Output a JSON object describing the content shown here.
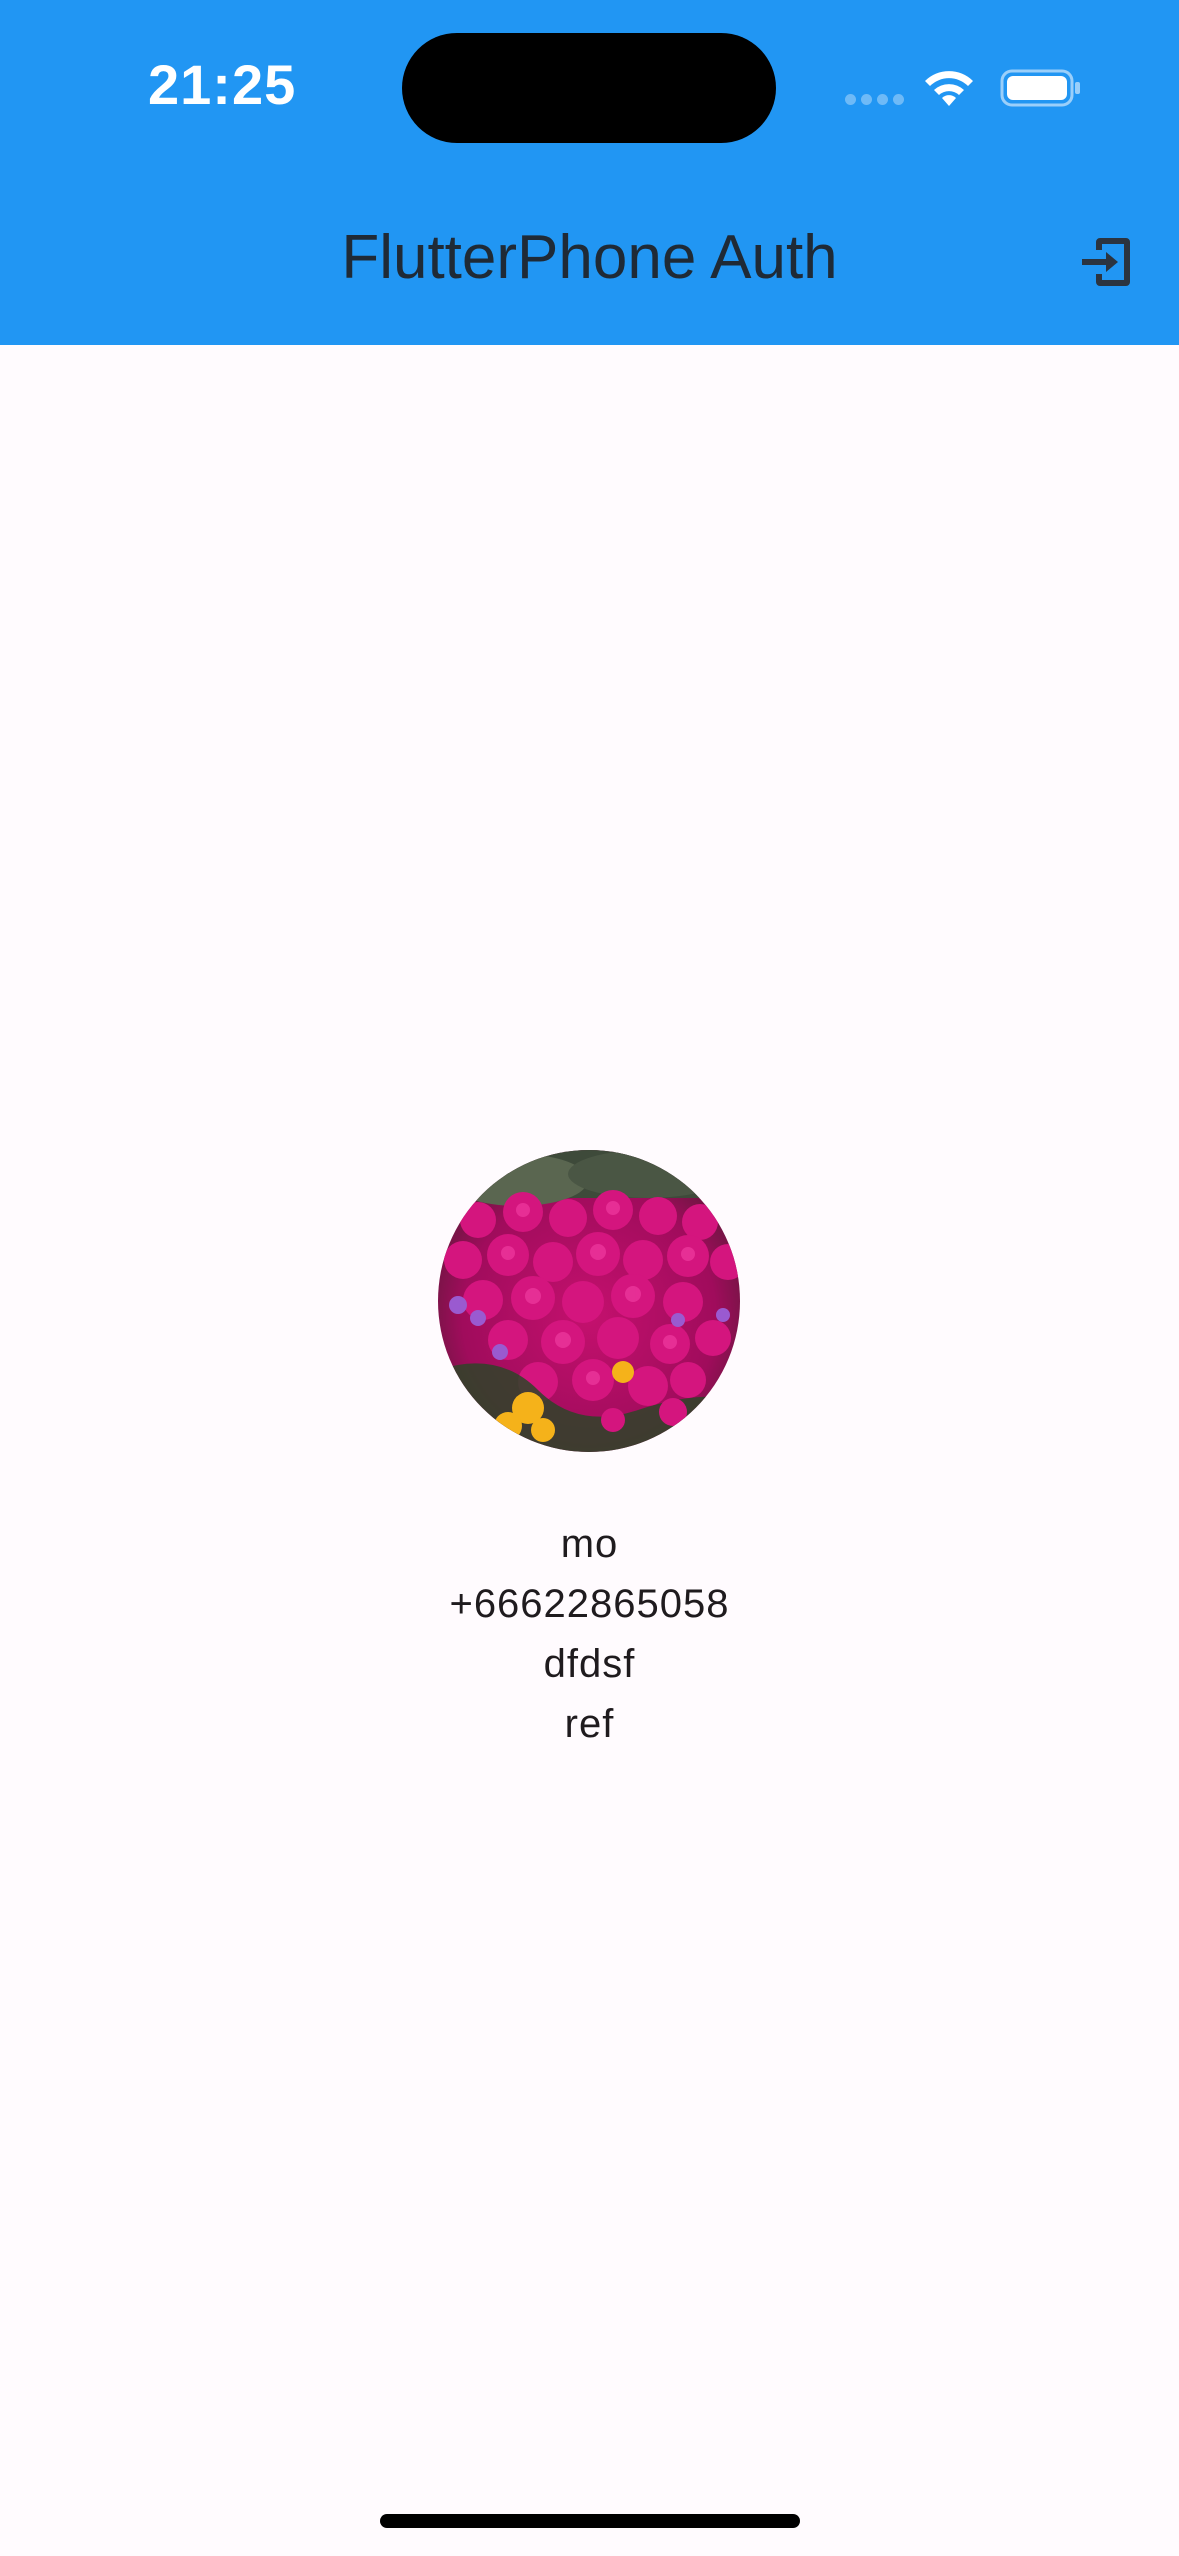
{
  "status_bar": {
    "time": "21:25"
  },
  "app_bar": {
    "title": "FlutterPhone Auth",
    "action_icon": "logout-icon",
    "color": "#2196f3"
  },
  "profile": {
    "avatar_alt": "profile photo",
    "name": "mo",
    "phone": "+66622865058",
    "field_1": "dfdsf",
    "field_2": "ref"
  }
}
